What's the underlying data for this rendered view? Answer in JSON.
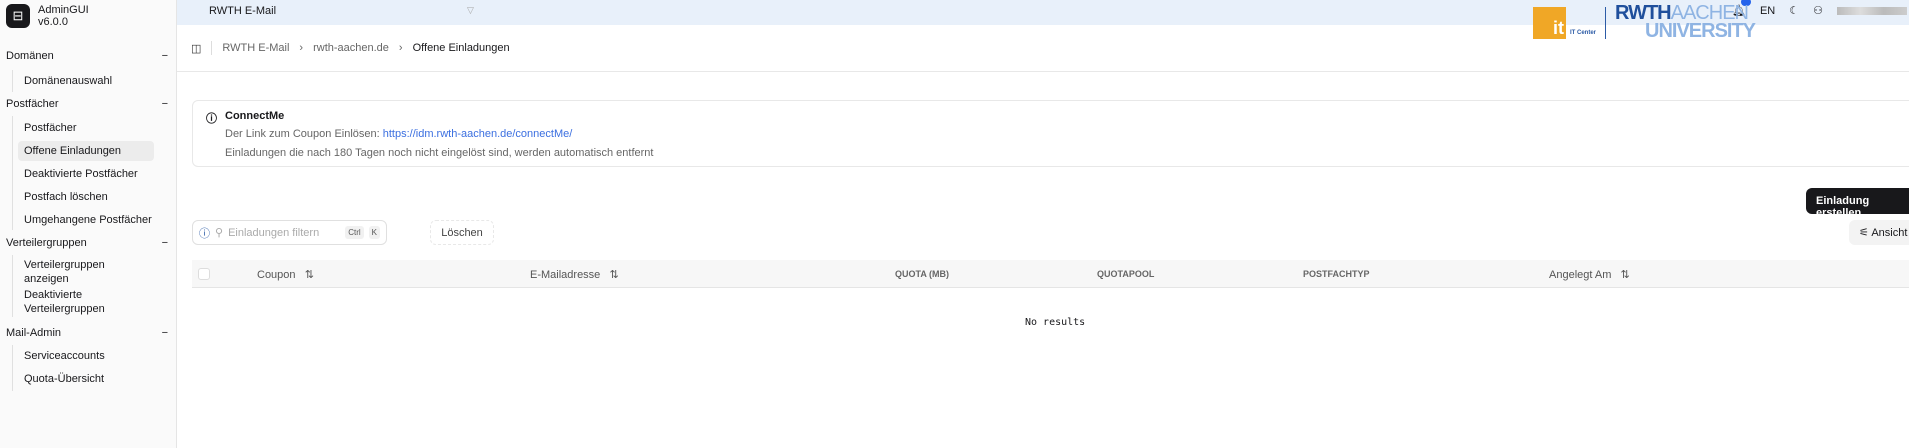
{
  "app": {
    "name": "AdminGUI",
    "version": "v6.0.0"
  },
  "sidebar": {
    "sections": [
      {
        "label": "Domänen",
        "items": [
          "Domänenauswahl"
        ]
      },
      {
        "label": "Postfächer",
        "items": [
          "Postfächer",
          "Offene Einladungen",
          "Deaktivierte Postfächer",
          "Postfach löschen",
          "Umgehangene Postfächer"
        ]
      },
      {
        "label": "Verteilergruppen",
        "items": [
          "Verteilergruppen anzeigen",
          "Deaktivierte Verteilergruppen"
        ]
      },
      {
        "label": "Mail-Admin",
        "items": [
          "Serviceaccounts",
          "Quota-Übersicht"
        ]
      }
    ],
    "collapse_symbol": "−",
    "active": "Offene Einladungen"
  },
  "topbar": {
    "service": "RWTH E-Mail",
    "language": "EN"
  },
  "breadcrumb": [
    "RWTH E-Mail",
    "rwth-aachen.de",
    "Offene Einladungen"
  ],
  "logos": {
    "it": "it",
    "it_center": "IT Center",
    "rwth": "RWTH",
    "aachen": "AACHEN",
    "university": "UNIVERSITY"
  },
  "info": {
    "title": "ConnectMe",
    "line1_prefix": "Der Link zum Coupon Einlösen: ",
    "link": "https://idm.rwth-aachen.de/connectMe/",
    "line2": "Einladungen die nach 180 Tagen noch nicht eingelöst sind, werden automatisch entfernt"
  },
  "actions": {
    "create": "Einladung erstellen",
    "view": "Ansicht",
    "clear": "Löschen"
  },
  "filter": {
    "placeholder": "Einladungen filtern",
    "kbd1": "Ctrl",
    "kbd2": "K"
  },
  "table": {
    "columns": [
      "Coupon",
      "E-Mailadresse",
      "QUOTA (MB)",
      "QUOTAPOOL",
      "POSTFACHTYP",
      "Angelegt Am"
    ],
    "empty": "No results",
    "sort_icon": "⇅"
  }
}
